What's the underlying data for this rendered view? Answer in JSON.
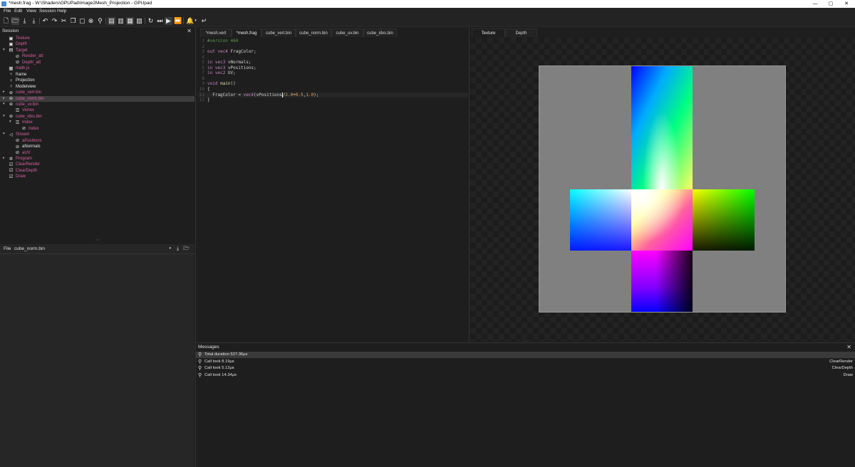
{
  "window": {
    "title": "*mesh.frag - W:\\Shaders\\GPUPad\\Image2Mesh_Projection - GPUpad",
    "controls": [
      "—",
      "▢",
      "✕"
    ]
  },
  "menu": [
    "File",
    "Edit",
    "View",
    "Session",
    "Help"
  ],
  "session": {
    "title": "Session",
    "items": [
      {
        "label": "Texture",
        "color": "pink",
        "icon": "image-icon",
        "glyph": "▣",
        "indent": 0,
        "arrow": ""
      },
      {
        "label": "Depth",
        "color": "pink",
        "icon": "image-icon",
        "glyph": "▣",
        "indent": 0,
        "arrow": ""
      },
      {
        "label": "Target",
        "color": "pink",
        "icon": "target-icon",
        "glyph": "▤",
        "indent": 0,
        "arrow": "▾"
      },
      {
        "label": "Render_att",
        "color": "pink",
        "icon": "attachment-icon",
        "glyph": "⊘",
        "indent": 1,
        "arrow": ""
      },
      {
        "label": "Depth_att",
        "color": "pink",
        "icon": "attachment-icon",
        "glyph": "⊘",
        "indent": 1,
        "arrow": ""
      },
      {
        "label": "math.js",
        "color": "pink",
        "icon": "script-icon",
        "glyph": "▦",
        "indent": 0,
        "arrow": ""
      },
      {
        "label": "frame",
        "color": "white",
        "icon": "variable-icon",
        "glyph": "♀",
        "indent": 0,
        "arrow": ""
      },
      {
        "label": "Projection",
        "color": "white",
        "icon": "variable-icon",
        "glyph": "♀",
        "indent": 0,
        "arrow": ""
      },
      {
        "label": "Modelview",
        "color": "white",
        "icon": "variable-icon",
        "glyph": "♀",
        "indent": 0,
        "arrow": ""
      },
      {
        "label": "cube_vert.bin",
        "color": "pink",
        "icon": "buffer-icon",
        "glyph": "⊜",
        "indent": 0,
        "arrow": "▸"
      },
      {
        "label": "cube_norm.bin",
        "color": "pink",
        "icon": "buffer-icon",
        "glyph": "⊜",
        "indent": 0,
        "arrow": "▸",
        "selected": true
      },
      {
        "label": "cube_uv.bin",
        "color": "pink",
        "icon": "buffer-icon",
        "glyph": "⊜",
        "indent": 0,
        "arrow": "▾"
      },
      {
        "label": "Vertex",
        "color": "pink",
        "icon": "block-icon",
        "glyph": "☰",
        "indent": 1,
        "arrow": ""
      },
      {
        "label": "cube_idxs.bin",
        "color": "pink",
        "icon": "buffer-icon",
        "glyph": "⊜",
        "indent": 0,
        "arrow": "▾"
      },
      {
        "label": "Index",
        "color": "pink",
        "icon": "block-icon",
        "glyph": "☰",
        "indent": 1,
        "arrow": "▾"
      },
      {
        "label": "Index",
        "color": "pink",
        "icon": "field-icon",
        "glyph": "⊘",
        "indent": 2,
        "arrow": ""
      },
      {
        "label": "Stream",
        "color": "pink",
        "icon": "stream-icon",
        "glyph": "◁",
        "indent": 0,
        "arrow": "▾"
      },
      {
        "label": "aPositions",
        "color": "pink",
        "icon": "attribute-icon",
        "glyph": "⊘",
        "indent": 1,
        "arrow": ""
      },
      {
        "label": "aNormals",
        "color": "white",
        "icon": "attribute-icon",
        "glyph": "⊘",
        "indent": 1,
        "arrow": ""
      },
      {
        "label": "aUV",
        "color": "pink",
        "icon": "attribute-icon",
        "glyph": "⊘",
        "indent": 1,
        "arrow": ""
      },
      {
        "label": "Program",
        "color": "pink",
        "icon": "program-icon",
        "glyph": "✲",
        "indent": 0,
        "arrow": "▸"
      },
      {
        "label": "ClearRender",
        "color": "pink",
        "icon": "call-icon",
        "glyph": "☑",
        "indent": 0,
        "arrow": ""
      },
      {
        "label": "ClearDepth",
        "color": "pink",
        "icon": "call-icon",
        "glyph": "☑",
        "indent": 0,
        "arrow": ""
      },
      {
        "label": "Draw",
        "color": "pink",
        "icon": "call-icon",
        "glyph": "☑",
        "indent": 0,
        "arrow": ""
      }
    ]
  },
  "file_panel": {
    "label": "File",
    "selected": "cube_norm.bin"
  },
  "editor": {
    "tabs": [
      "*mesh.vert",
      "*mesh.frag",
      "cube_vert.bin",
      "cube_norm.bin",
      "cube_uv.bin",
      "cube_idxs.bin"
    ],
    "active_tab": 1,
    "lines": [
      {
        "n": "1",
        "t": "#version 460"
      },
      {
        "n": "2",
        "t": ""
      },
      {
        "n": "3",
        "t": "out vec4 FragColor;"
      },
      {
        "n": "4",
        "t": ""
      },
      {
        "n": "5",
        "t": "in vec3 vNormals;"
      },
      {
        "n": "6",
        "t": "in vec3 vPositions;"
      },
      {
        "n": "7",
        "t": "in vec2 UV;"
      },
      {
        "n": "8",
        "t": ""
      },
      {
        "n": "9",
        "t": "void main()"
      },
      {
        "n": "10",
        "t": "{"
      },
      {
        "n": "11",
        "t": "  FragColor = vec4(vPositions/2.0+0.5,1.0);"
      },
      {
        "n": "12",
        "t": "}"
      }
    ],
    "current_line": 11
  },
  "preview": {
    "tabs": [
      "Texture",
      "Depth"
    ],
    "active_tab": 0
  },
  "messages": {
    "title": "Messages",
    "rows": [
      {
        "text": "Total duration 527.36μs",
        "source": "",
        "selected": true
      },
      {
        "text": "Call took 8.19μs",
        "source": "ClearRender"
      },
      {
        "text": "Call took 5.12μs",
        "source": "ClearDepth"
      },
      {
        "text": "Call took 14.34μs",
        "source": "Draw"
      }
    ]
  },
  "colors": {
    "pink_label": "#d5609e",
    "selection": "#3d3d3d",
    "background": "#1e1e1e"
  }
}
